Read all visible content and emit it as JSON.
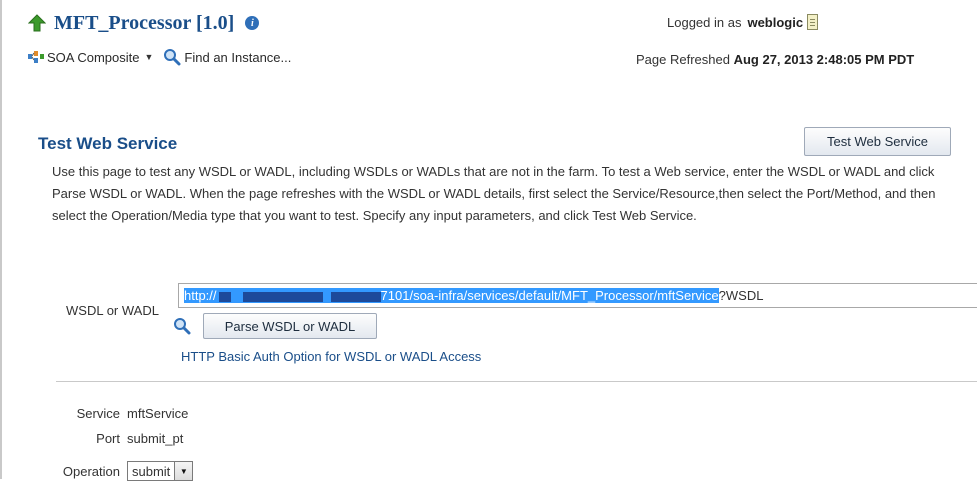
{
  "header": {
    "title": "MFT_Processor [1.0]",
    "info_icon": "i",
    "logged_in_label": "Logged in as",
    "username": "weblogic"
  },
  "toolbar": {
    "composite_menu_label": "SOA Composite",
    "find_instance_label": "Find an Instance...",
    "page_refreshed_label": "Page Refreshed",
    "page_refreshed_date": "Aug 27, 2013 2:48:05 PM PDT"
  },
  "section": {
    "title": "Test Web Service",
    "test_button_label": "Test Web Service",
    "description": "Use this page to test any WSDL or WADL, including WSDLs or WADLs that are not in the farm. To test a Web service, enter the WSDL or WADL and click Parse WSDL or WADL. When the page refreshes with the WSDL or WADL details, first select the Service/Resource,then select the Port/Method, and then select the Operation/Media type that you want to test. Specify any input parameters, and click Test Web Service."
  },
  "form": {
    "wsdl_label": "WSDL or WADL",
    "wsdl_value_prefix": "http://",
    "wsdl_value_selected_rest": "7101/soa-infra/services/default/MFT_Processor/mftService",
    "wsdl_value_suffix": "?WSDL",
    "parse_button_label": "Parse WSDL or WADL",
    "auth_link_label": "HTTP Basic Auth Option for WSDL or WADL Access",
    "service_label": "Service",
    "service_value": "mftService",
    "port_label": "Port",
    "port_value": "submit_pt",
    "operation_label": "Operation",
    "operation_value": "submit"
  },
  "colors": {
    "title_blue": "#1a4e89",
    "selection_blue": "#3399ff"
  }
}
